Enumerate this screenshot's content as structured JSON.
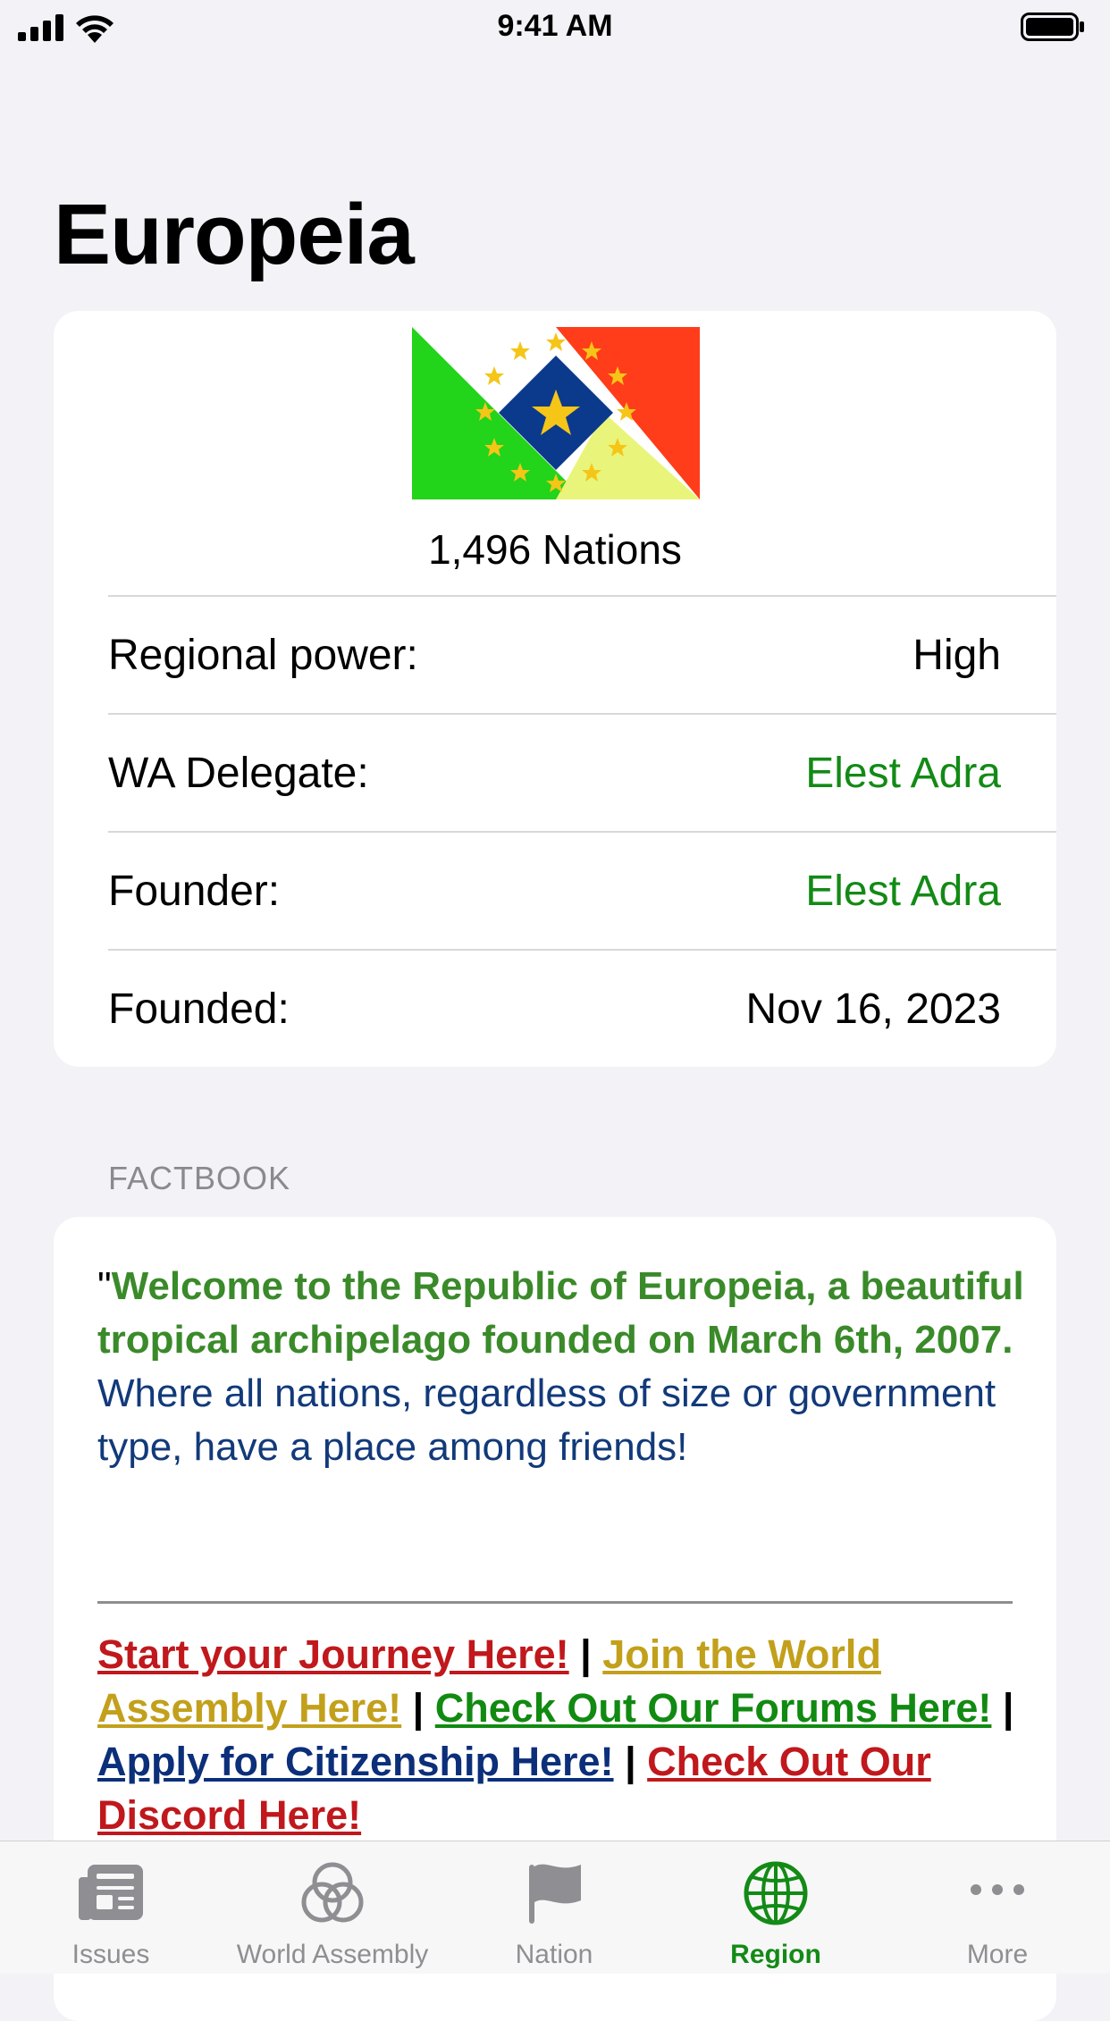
{
  "status_bar": {
    "time": "9:41 AM"
  },
  "page": {
    "title": "Europeia"
  },
  "region": {
    "nation_count": "1,496 Nations",
    "rows": [
      {
        "label": "Regional power:",
        "value": "High"
      },
      {
        "label": "WA Delegate:",
        "value": "Elest Adra"
      },
      {
        "label": "Founder:",
        "value": "Elest Adra"
      },
      {
        "label": "Founded:",
        "value": "Nov 16, 2023"
      }
    ],
    "link_color": "#138a16"
  },
  "factbook": {
    "header": "FACTBOOK",
    "quote_mark": "\"",
    "welcome": "Welcome to the Republic of Europeia, a beautiful tropical archipelago founded on March 6th, 2007.",
    "tagline": "Where all nations, regardless of size or government type, have a place among friends!",
    "separator": " | ",
    "links": [
      {
        "text": "Start your Journey Here!",
        "color": "#c0181c"
      },
      {
        "text": "Join the World Assembly Here!",
        "color": "#c2a01b"
      },
      {
        "text": "Check Out Our Forums Here!",
        "color": "#118a11"
      },
      {
        "text": "Apply for Citizenship Here!",
        "color": "#0c2f7a"
      },
      {
        "text": "Check Out Our Discord Here!",
        "color": "#c0181c"
      }
    ]
  },
  "tab_bar": {
    "tabs": [
      {
        "label": "Issues",
        "icon": "newspaper-icon"
      },
      {
        "label": "World Assembly",
        "icon": "three-rings-icon"
      },
      {
        "label": "Nation",
        "icon": "flag-icon"
      },
      {
        "label": "Region",
        "icon": "globe-icon",
        "active": true
      },
      {
        "label": "More",
        "icon": "ellipsis-icon"
      }
    ],
    "active_color": "#138a16",
    "inactive_color": "#8e8e93"
  }
}
